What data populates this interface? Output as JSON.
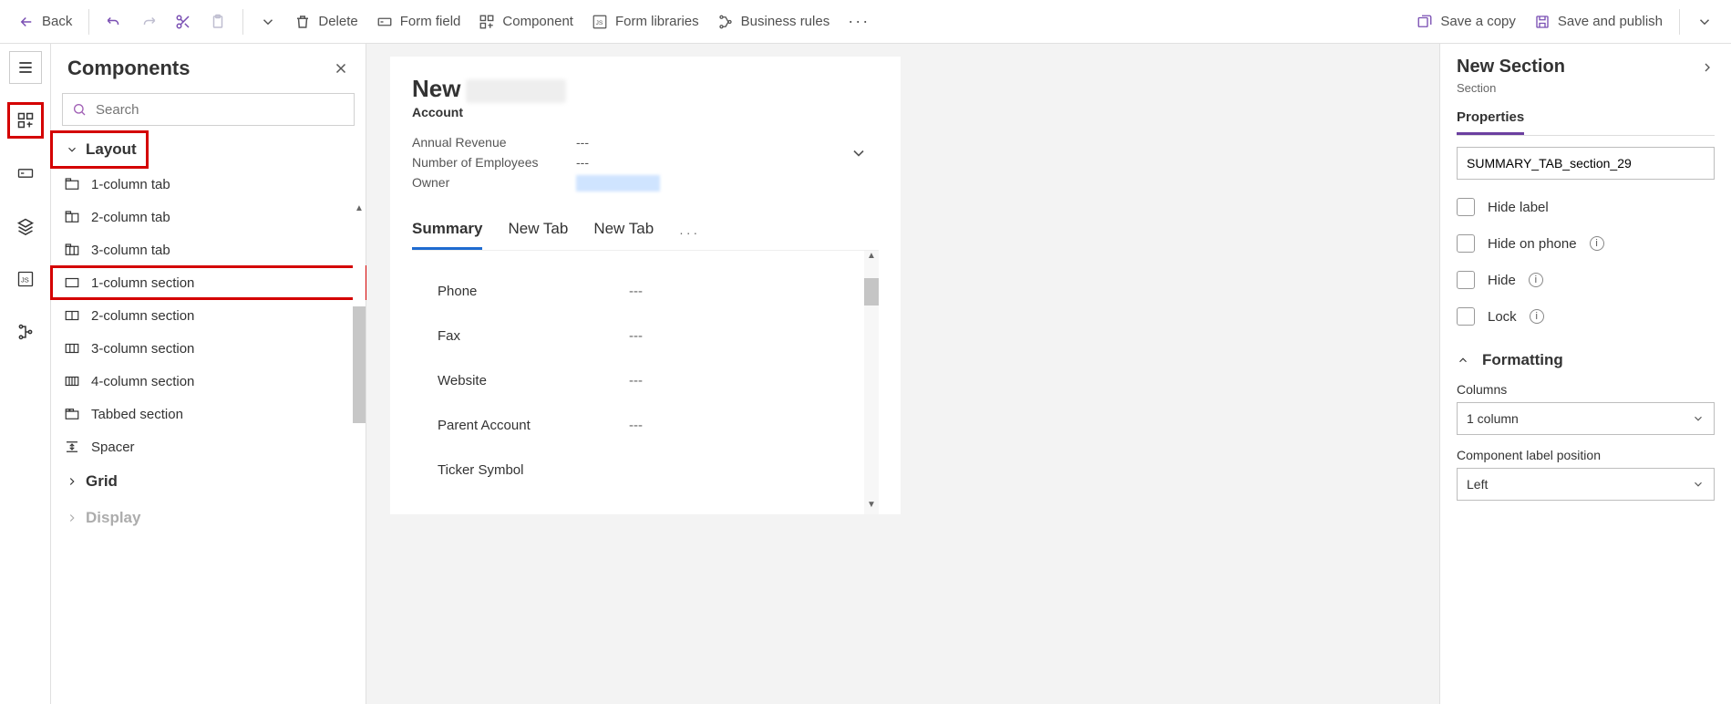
{
  "toolbar": {
    "back": "Back",
    "delete": "Delete",
    "formfield": "Form field",
    "component": "Component",
    "formlibs": "Form libraries",
    "bizrules": "Business rules",
    "savecopy": "Save a copy",
    "savepub": "Save and publish"
  },
  "components": {
    "title": "Components",
    "search_placeholder": "Search",
    "layout_header": "Layout",
    "items": [
      "1-column tab",
      "2-column tab",
      "3-column tab",
      "1-column section",
      "2-column section",
      "3-column section",
      "4-column section",
      "Tabbed section",
      "Spacer"
    ],
    "grid_header": "Grid",
    "display_header": "Display"
  },
  "form": {
    "title_prefix": "New",
    "entity": "Account",
    "mini": {
      "annual_rev_label": "Annual Revenue",
      "annual_rev_val": "---",
      "employees_label": "Number of Employees",
      "employees_val": "---",
      "owner_label": "Owner"
    },
    "tabs": [
      "Summary",
      "New Tab",
      "New Tab"
    ],
    "active_tab": 0,
    "body_fields": [
      {
        "label": "Phone",
        "value": "---"
      },
      {
        "label": "Fax",
        "value": "---"
      },
      {
        "label": "Website",
        "value": "---"
      },
      {
        "label": "Parent Account",
        "value": "---"
      },
      {
        "label": "Ticker Symbol",
        "value": ""
      }
    ]
  },
  "props": {
    "title": "New Section",
    "subtitle": "Section",
    "tab": "Properties",
    "name_value": "SUMMARY_TAB_section_29",
    "checks": {
      "hide_label": "Hide label",
      "hide_phone": "Hide on phone",
      "hide": "Hide",
      "lock": "Lock"
    },
    "formatting_header": "Formatting",
    "columns_label": "Columns",
    "columns_value": "1 column",
    "clp_label": "Component label position",
    "clp_value": "Left"
  }
}
